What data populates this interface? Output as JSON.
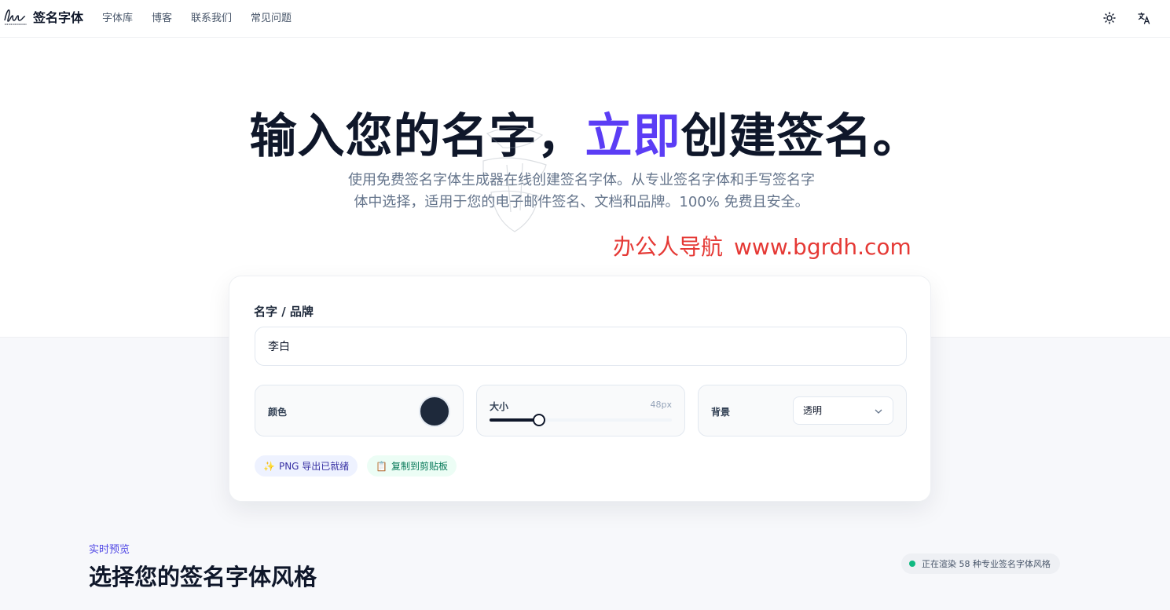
{
  "header": {
    "logo_text": "签名字体",
    "nav": [
      "字体库",
      "博客",
      "联系我们",
      "常见问题"
    ]
  },
  "hero": {
    "title_before": "输入您的名字，",
    "title_accent": "立即",
    "title_after": "创建签名。",
    "subtitle_line1": "使用免费签名字体生成器在线创建签名字体。从专业签名字体和手写签名字",
    "subtitle_line2": "体中选择，适用于您的电子邮件签名、文档和品牌。100% 免费且安全。"
  },
  "watermark": {
    "name": "办公人导航",
    "url": "www.bgrdh.com"
  },
  "form": {
    "name_label": "名字 / 品牌",
    "name_value": "李白",
    "color_label": "颜色",
    "color_value": "#1e293b",
    "size_label": "大小",
    "size_value": "48px",
    "size_fraction": 0.27,
    "background_label": "背景",
    "background_value": "透明",
    "badge_png": "PNG 导出已就绪",
    "badge_copy": "复制到剪贴板"
  },
  "preview": {
    "eyebrow": "实时预览",
    "title": "选择您的签名字体风格",
    "status": "正在渲染 58 种专业签名字体风格"
  },
  "colors": {
    "accent": "#5b3df5",
    "watermark": "#e53935",
    "status_dot": "#10b981"
  }
}
